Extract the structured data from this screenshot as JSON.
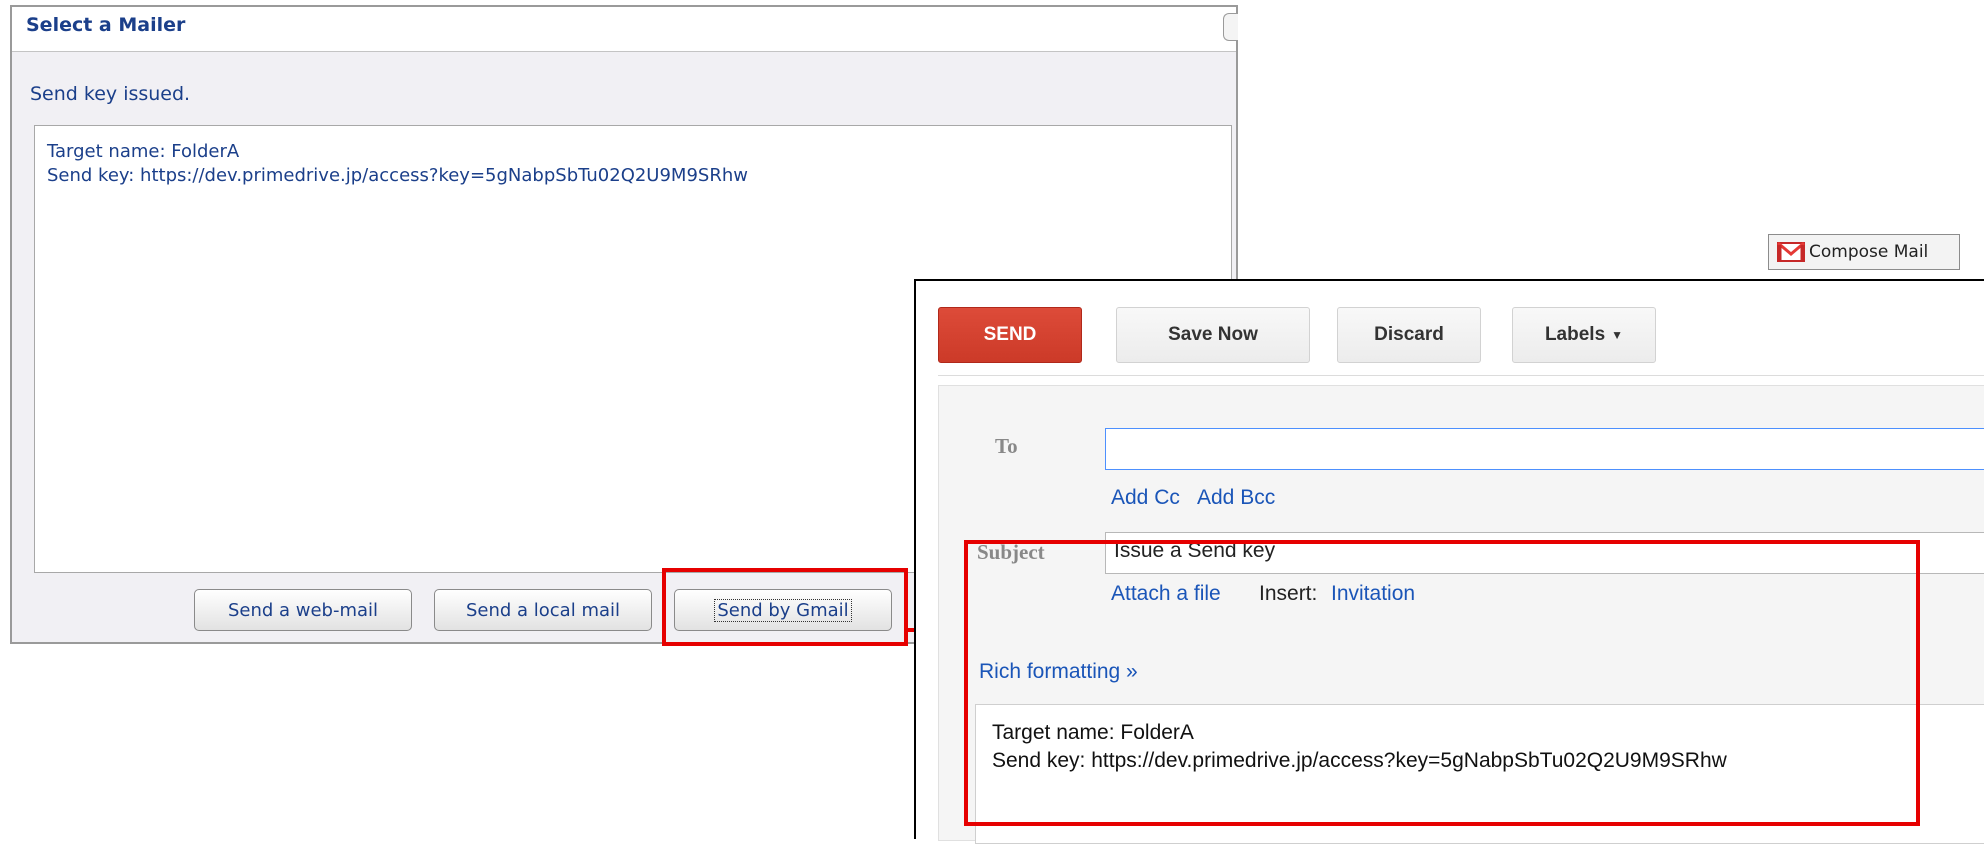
{
  "mailer": {
    "title": "Select a Mailer",
    "status": "Send key issued.",
    "body_line1": "Target name: FolderA",
    "body_line2": "Send key: https://dev.primedrive.jp/access?key=5gNabpSbTu02Q2U9M9SRhw",
    "buttons": {
      "web_mail": "Send a web-mail",
      "local_mail": "Send a local mail",
      "gmail": "Send by Gmail"
    }
  },
  "gmail": {
    "compose_mail": "Compose Mail",
    "toolbar": {
      "send": "SEND",
      "save_now": "Save Now",
      "discard": "Discard",
      "labels": "Labels"
    },
    "to_label": "To",
    "to_value": "",
    "add_cc": "Add Cc",
    "add_bcc": "Add Bcc",
    "subject_label": "Subject",
    "subject_value": "Issue a Send key",
    "attach_file": "Attach a file",
    "insert_label": "Insert:",
    "insert_invitation": "Invitation",
    "rich_formatting": "Rich formatting »",
    "message_line1": "Target name: FolderA",
    "message_line2": "Send key: https://dev.primedrive.jp/access?key=5gNabpSbTu02Q2U9M9SRhw"
  },
  "colors": {
    "highlight": "#e60000",
    "send_button": "#dd4b39",
    "link": "#1a55b8",
    "dialog_text": "#1b3f8a"
  }
}
